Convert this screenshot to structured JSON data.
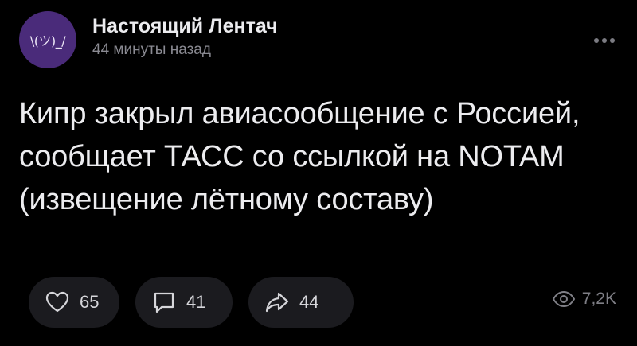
{
  "channel": {
    "avatar_text": "\\(ツ)_/",
    "name": "Настоящий Лентач",
    "timestamp": "44 минуты назад"
  },
  "post": {
    "text": "Кипр закрыл авиасообщение с Россией, сообщает ТАСС со ссылкой на NOTAM (извещение лётному составу)"
  },
  "actions": {
    "likes": "65",
    "comments": "41",
    "reposts": "44",
    "views": "7,2K"
  },
  "colors": {
    "background": "#000000",
    "avatar": "#4a2b7a",
    "pill": "#1b1b1f",
    "text": "#ececef",
    "muted": "#8a8a92"
  },
  "icons": {
    "likes": "heart-icon",
    "comments": "comment-icon",
    "reposts": "share-arrow-icon",
    "views": "eye-icon",
    "more": "more-dots-icon"
  }
}
